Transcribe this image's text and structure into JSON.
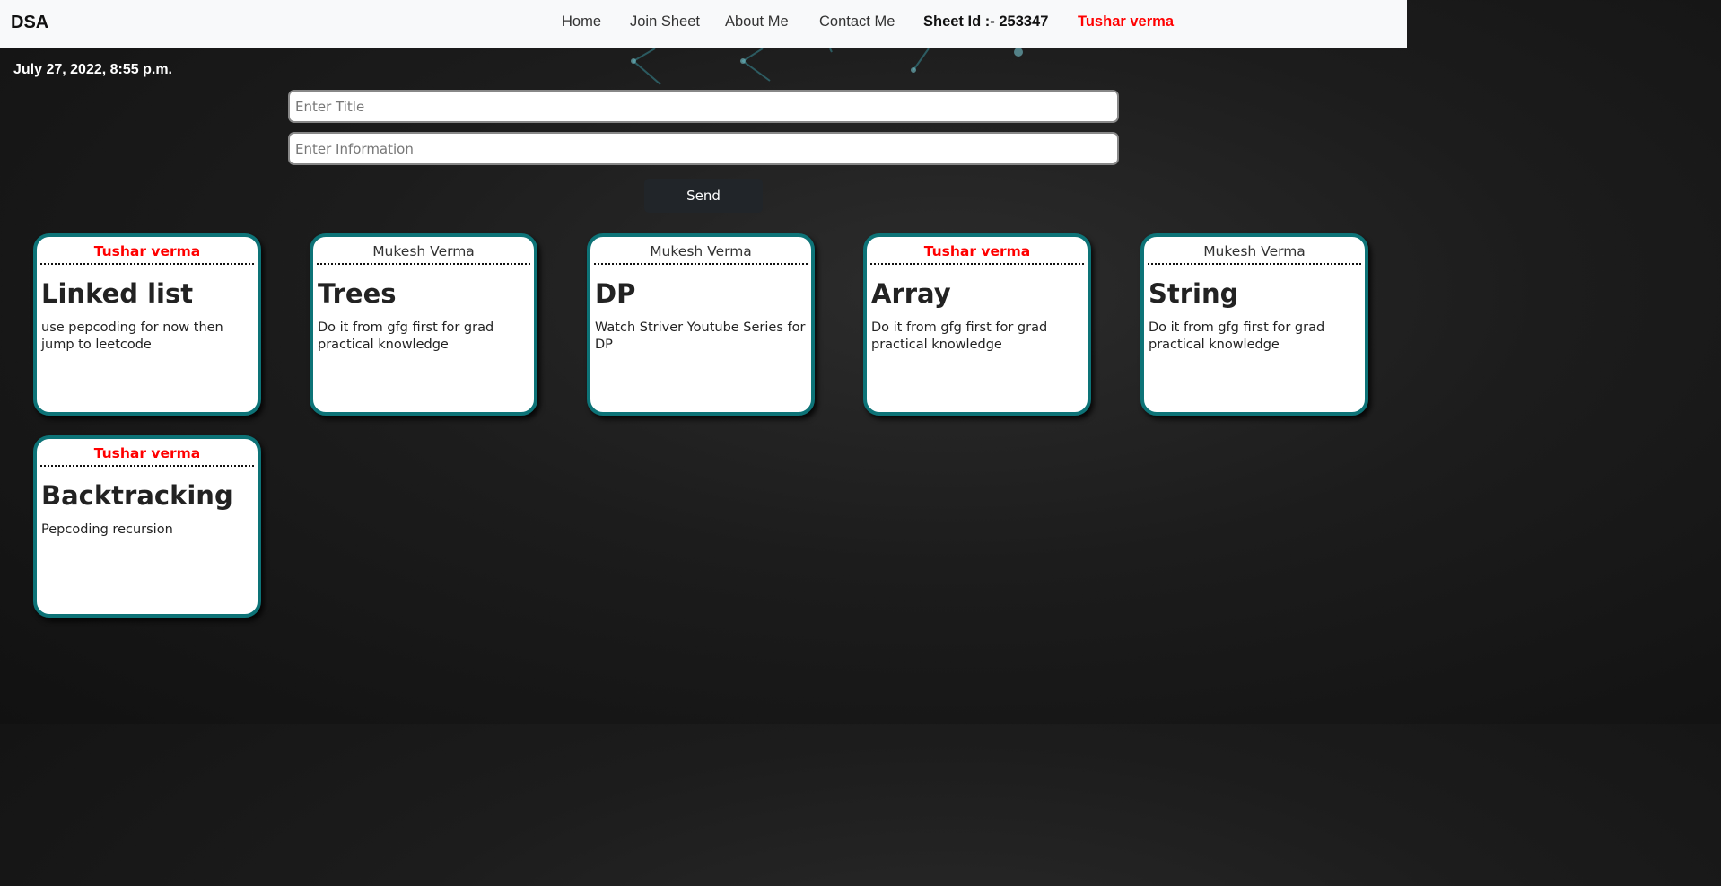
{
  "navbar": {
    "brand": "DSA",
    "links": [
      "Home",
      "Join Sheet",
      "About Me",
      "Contact Me"
    ],
    "sheet_id": "Sheet Id :- 253347",
    "user": "Tushar verma"
  },
  "date": "July 27, 2022, 8:55 p.m.",
  "form": {
    "title_placeholder": "Enter Title",
    "info_placeholder": "Enter Information",
    "send_label": "Send"
  },
  "cards": [
    {
      "author": "Tushar verma",
      "highlight": true,
      "title": "Linked list",
      "info": "use pepcoding for now then jump to leetcode"
    },
    {
      "author": "Mukesh Verma",
      "highlight": false,
      "title": "Trees",
      "info": "Do it from gfg first for grad practical knowledge"
    },
    {
      "author": "Mukesh Verma",
      "highlight": false,
      "title": "DP",
      "info": "Watch Striver Youtube Series for DP"
    },
    {
      "author": "Tushar verma",
      "highlight": true,
      "title": "Array",
      "info": "Do it from gfg first for grad practical knowledge"
    },
    {
      "author": "Mukesh Verma",
      "highlight": false,
      "title": "String",
      "info": "Do it from gfg first for grad practical knowledge"
    },
    {
      "author": "Tushar verma",
      "highlight": true,
      "title": "Backtracking",
      "info": "Pepcoding recursion"
    }
  ],
  "colors": {
    "highlight_author": "#ff0000",
    "normal_author": "#333333",
    "card_border": "#0d7377",
    "user_name": "#ff0000"
  }
}
